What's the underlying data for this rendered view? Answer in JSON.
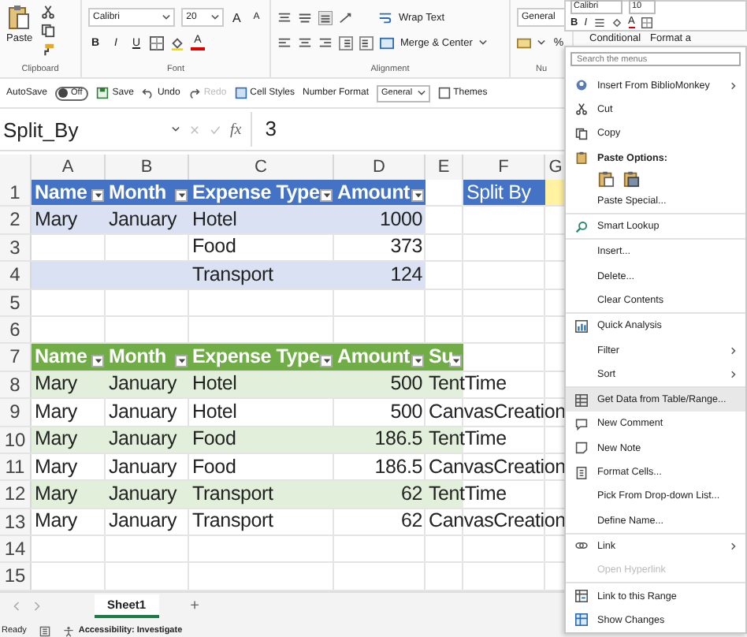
{
  "ribbon": {
    "clipboard": {
      "paste": "Paste",
      "label": "Clipboard"
    },
    "font": {
      "family": "Calibri",
      "size": "20",
      "grow": "A",
      "shrink": "A",
      "bold": "B",
      "italic": "I",
      "underline": "U",
      "font_color_letter": "A",
      "label": "Font"
    },
    "alignment": {
      "wrap": "Wrap Text",
      "merge": "Merge & Center",
      "label": "Alignment"
    },
    "number": {
      "format": "General",
      "percent": "%",
      "label": "Nu"
    },
    "styles": [
      "Conditional",
      "Format a"
    ]
  },
  "mini_toolbar": {
    "font": "Calibri",
    "size": "10",
    "bold": "B",
    "italic": "I",
    "font_color_letter": "A"
  },
  "quick_access": {
    "autosave": "AutoSave",
    "toggle": {
      "label": "Off",
      "on": false
    },
    "items": [
      {
        "label": "Save",
        "disabled": false
      },
      {
        "label": "Undo",
        "disabled": false
      },
      {
        "label": "Redo",
        "disabled": true
      },
      {
        "label": "Cell Styles",
        "disabled": false
      }
    ],
    "number_format": "Number Format",
    "number_value": "General",
    "themes": "Themes"
  },
  "formula_bar": {
    "name_box": "Split_By",
    "function_label": "fx",
    "value": "3"
  },
  "grid": {
    "columns": [
      "A",
      "B",
      "C",
      "D",
      "E",
      "F",
      "G"
    ],
    "rows": [
      {
        "number": "1",
        "cells": [
          {
            "text": "Name",
            "color": "#4472c4",
            "kind": "header",
            "filter": true
          },
          {
            "text": "Month",
            "color": "#4472c4",
            "kind": "header",
            "filter": true
          },
          {
            "text": "Expense Type",
            "color": "#4472c4",
            "kind": "header",
            "filter": true
          },
          {
            "text": "Amount",
            "color": "#4472c4",
            "kind": "header",
            "filter": true
          },
          null,
          {
            "text": "Split By",
            "color": "#4472c4",
            "kind": "label"
          },
          {
            "color": "#fff2a0"
          }
        ]
      },
      {
        "number": "2",
        "cells": [
          {
            "text": "Mary",
            "color": "#d9e1f2"
          },
          {
            "text": "January",
            "color": "#d9e1f2"
          },
          {
            "text": "Hotel",
            "color": "#d9e1f2"
          },
          {
            "text": "1000",
            "color": "#d9e1f2",
            "kind": "number"
          }
        ]
      },
      {
        "number": "3",
        "cells": [
          null,
          null,
          {
            "text": "Food"
          },
          {
            "text": "373",
            "kind": "number"
          }
        ]
      },
      {
        "number": "4",
        "cells": [
          {
            "color": "#d9e1f2"
          },
          {
            "color": "#d9e1f2"
          },
          {
            "text": "Transport",
            "color": "#d9e1f2"
          },
          {
            "text": "124",
            "color": "#d9e1f2",
            "kind": "number"
          }
        ]
      },
      {
        "number": "5",
        "cells": []
      },
      {
        "number": "6",
        "cells": []
      },
      {
        "number": "7",
        "cells": [
          {
            "text": "Name",
            "color": "#70ad47",
            "kind": "header",
            "filter": true
          },
          {
            "text": "Month",
            "color": "#70ad47",
            "kind": "header",
            "filter": true
          },
          {
            "text": "Expense Type",
            "color": "#70ad47",
            "kind": "header",
            "filter": true
          },
          {
            "text": "Amount",
            "color": "#70ad47",
            "kind": "header",
            "filter": true
          },
          {
            "text": "Su",
            "color": "#70ad47",
            "kind": "header",
            "filter": true
          }
        ]
      },
      {
        "number": "8",
        "cells": [
          {
            "text": "Mary",
            "color": "#e2efda"
          },
          {
            "text": "January",
            "color": "#e2efda"
          },
          {
            "text": "Hotel",
            "color": "#e2efda"
          },
          {
            "text": "500",
            "color": "#e2efda",
            "kind": "number"
          },
          {
            "text": "TentTime",
            "color": "#e2efda"
          }
        ]
      },
      {
        "number": "9",
        "cells": [
          {
            "text": "Mary"
          },
          {
            "text": "January"
          },
          {
            "text": "Hotel"
          },
          {
            "text": "500",
            "kind": "number"
          },
          {
            "text": "CanvasCreation"
          }
        ]
      },
      {
        "number": "10",
        "cells": [
          {
            "text": "Mary",
            "color": "#e2efda"
          },
          {
            "text": "January",
            "color": "#e2efda"
          },
          {
            "text": "Food",
            "color": "#e2efda"
          },
          {
            "text": "186.5",
            "color": "#e2efda",
            "kind": "number"
          },
          {
            "text": "TentTime",
            "color": "#e2efda"
          }
        ]
      },
      {
        "number": "11",
        "cells": [
          {
            "text": "Mary"
          },
          {
            "text": "January"
          },
          {
            "text": "Food"
          },
          {
            "text": "186.5",
            "kind": "number"
          },
          {
            "text": "CanvasCreation"
          }
        ]
      },
      {
        "number": "12",
        "cells": [
          {
            "text": "Mary",
            "color": "#e2efda"
          },
          {
            "text": "January",
            "color": "#e2efda"
          },
          {
            "text": "Transport",
            "color": "#e2efda"
          },
          {
            "text": "62",
            "color": "#e2efda",
            "kind": "number"
          },
          {
            "text": "TentTime",
            "color": "#e2efda"
          }
        ]
      },
      {
        "number": "13",
        "cells": [
          {
            "text": "Mary"
          },
          {
            "text": "January"
          },
          {
            "text": "Transport"
          },
          {
            "text": "62",
            "kind": "number"
          },
          {
            "text": "CanvasCreation"
          }
        ]
      },
      {
        "number": "14",
        "cells": []
      },
      {
        "number": "15",
        "cells": []
      }
    ]
  },
  "sheet_tabs": {
    "tabs": [
      {
        "label": "Sheet1",
        "selected": true
      }
    ],
    "add": "+"
  },
  "status_bar": {
    "state": "Ready",
    "accessibility": "Accessibility: Investigate"
  },
  "context_menu": {
    "search": {
      "placeholder": "Search the menus"
    },
    "items": [
      {
        "kind": "item",
        "label": "Insert From BiblioMonkey",
        "submenu": true,
        "selected": false,
        "disabled": false,
        "separator_before": false
      },
      {
        "kind": "item",
        "label": "Cut",
        "submenu": false,
        "selected": false,
        "disabled": false,
        "separator_before": false
      },
      {
        "kind": "item",
        "label": "Copy",
        "submenu": false,
        "selected": false,
        "disabled": false,
        "separator_before": false
      },
      {
        "kind": "heading",
        "label": "Paste Options:"
      },
      {
        "kind": "paste-options"
      },
      {
        "kind": "item",
        "label": "Paste Special...",
        "submenu": false,
        "selected": false,
        "disabled": false,
        "separator_before": false
      },
      {
        "kind": "item",
        "label": "Smart Lookup",
        "submenu": false,
        "selected": false,
        "disabled": false,
        "separator_before": true
      },
      {
        "kind": "item",
        "label": "Insert...",
        "submenu": false,
        "selected": false,
        "disabled": false,
        "separator_before": true
      },
      {
        "kind": "item",
        "label": "Delete...",
        "submenu": false,
        "selected": false,
        "disabled": false,
        "separator_before": false
      },
      {
        "kind": "item",
        "label": "Clear Contents",
        "submenu": false,
        "selected": false,
        "disabled": false,
        "separator_before": false
      },
      {
        "kind": "item",
        "label": "Quick Analysis",
        "submenu": false,
        "selected": false,
        "disabled": false,
        "separator_before": true
      },
      {
        "kind": "item",
        "label": "Filter",
        "submenu": true,
        "selected": false,
        "disabled": false,
        "separator_before": false
      },
      {
        "kind": "item",
        "label": "Sort",
        "submenu": true,
        "selected": false,
        "disabled": false,
        "separator_before": false
      },
      {
        "kind": "item",
        "label": "Get Data from Table/Range...",
        "submenu": false,
        "selected": true,
        "disabled": false,
        "separator_before": true
      },
      {
        "kind": "item",
        "label": "New Comment",
        "submenu": false,
        "selected": false,
        "disabled": false,
        "separator_before": false
      },
      {
        "kind": "item",
        "label": "New Note",
        "submenu": false,
        "selected": false,
        "disabled": false,
        "separator_before": false
      },
      {
        "kind": "item",
        "label": "Format Cells...",
        "submenu": false,
        "selected": false,
        "disabled": false,
        "separator_before": false
      },
      {
        "kind": "item",
        "label": "Pick From Drop-down List...",
        "submenu": false,
        "selected": false,
        "disabled": false,
        "separator_before": false
      },
      {
        "kind": "item",
        "label": "Define Name...",
        "submenu": false,
        "selected": false,
        "disabled": false,
        "separator_before": false
      },
      {
        "kind": "item",
        "label": "Link",
        "submenu": true,
        "selected": false,
        "disabled": false,
        "separator_before": true
      },
      {
        "kind": "item",
        "label": "Open Hyperlink",
        "submenu": false,
        "selected": false,
        "disabled": true,
        "separator_before": false
      },
      {
        "kind": "item",
        "label": "Link to this Range",
        "submenu": false,
        "selected": false,
        "disabled": false,
        "separator_before": true
      },
      {
        "kind": "item",
        "label": "Show Changes",
        "submenu": false,
        "selected": false,
        "disabled": false,
        "separator_before": false
      }
    ]
  }
}
